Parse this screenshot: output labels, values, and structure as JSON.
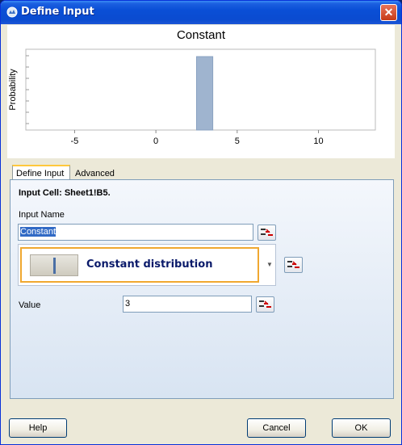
{
  "window": {
    "title": "Define Input"
  },
  "chart_data": {
    "type": "bar",
    "title": "Constant",
    "ylabel": "Probability",
    "xlabel": "",
    "xlim": [
      -8,
      13.5
    ],
    "x_ticks": [
      -5,
      0,
      5,
      10
    ],
    "bars": [
      {
        "x_start": 2.5,
        "x_end": 3.5,
        "value": 1
      }
    ],
    "ylim": [
      0,
      1.1
    ],
    "grid": false,
    "bar_color": "#9fb4cf"
  },
  "tabs": [
    {
      "label": "Define Input",
      "active": true
    },
    {
      "label": "Advanced",
      "active": false
    }
  ],
  "panel": {
    "input_cell": "Input Cell: Sheet1!B5.",
    "input_name_label": "Input Name",
    "input_name_value": "Constant",
    "distribution_label": "Constant distribution",
    "value_label": "Value",
    "value_value": "3"
  },
  "buttons": {
    "help": "Help",
    "cancel": "Cancel",
    "ok": "OK"
  },
  "colors": {
    "titlebar": "#0a4fd6",
    "accent": "#f0a830"
  }
}
